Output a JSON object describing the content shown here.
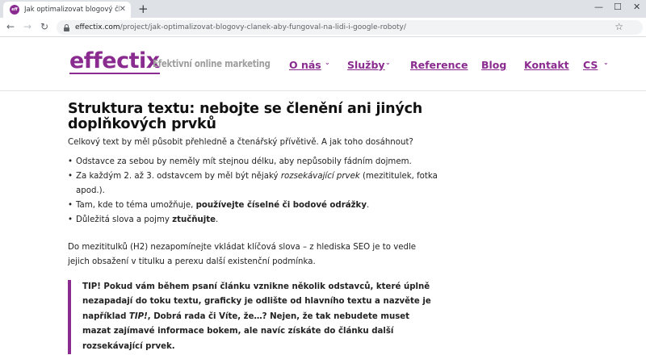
{
  "browser": {
    "tab_title": "Jak optimalizovat blogový článek",
    "favicon_text": "eff",
    "url_host": "effectix.com",
    "url_path": "/project/jak-optimalizovat-blogovy-clanek-aby-fungoval-na-lidi-i-google-roboty/"
  },
  "site": {
    "logo": "effectix",
    "tagline": "Efektivní online marketing",
    "nav": [
      "O nás",
      "Služby",
      "Reference",
      "Blog",
      "Kontakt",
      "CS"
    ],
    "accent_color": "#8a2b8f"
  },
  "article": {
    "heading": "Struktura textu: nebojte se členění ani jiných doplňkových prvků",
    "intro": "Celkový text by měl působit přehledně a čtenářský přívětivě. A jak toho dosáhnout?",
    "bullets": {
      "b1": "Odstavce za sebou by neměly mít stejnou délku, aby nepůsobily fádním dojmem.",
      "b2_pre": "Za každým 2. až 3. odstavcem by měl být nějaký ",
      "b2_em": "rozsekávající prvek",
      "b2_post": " (mezititulek, fotka apod.).",
      "b3_pre": "Tam, kde to téma umožňuje, ",
      "b3_strong": "používejte číselné či bodové odrážky",
      "b3_post": ".",
      "b4_pre": "Důležitá slova a pojmy ",
      "b4_strong": "ztučňujte",
      "b4_post": "."
    },
    "paragraph": "Do mezititulků (H2) nezapomínejte vkládat klíčová slova – z hlediska SEO je to vedle jejich obsažení v titulku a perexu další existenční podmínka.",
    "tip_pre": "TIP! Pokud vám během psaní článku vznikne několik odstavců, které úplně nezapadají do toku textu, graficky je odlište od hlavního textu a nazvěte je například ",
    "tip_em": "TIP!",
    "tip_post": ", Dobrá rada či Víte, že…? Nejen, že tak nebudete muset mazat zajímavé informace bokem, ale navíc získáte do článku další rozsekávající prvek."
  }
}
